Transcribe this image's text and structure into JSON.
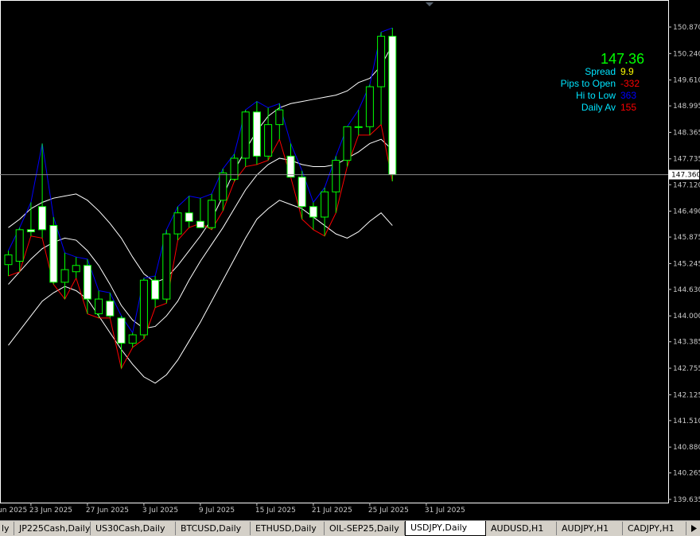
{
  "chart_data": {
    "type": "candlestick",
    "symbol_timeframe": "USDJPY,Daily",
    "ylim": [
      139.635,
      151.05
    ],
    "y_ticks": [
      "150.870",
      "150.240",
      "149.610",
      "148.995",
      "148.365",
      "147.735",
      "147.120",
      "146.490",
      "145.875",
      "145.245",
      "144.630",
      "144.000",
      "143.385",
      "142.755",
      "142.125",
      "141.510",
      "140.880",
      "140.265",
      "139.635"
    ],
    "x_ticks": [
      "19 Jun 2025",
      "23 Jun 2025",
      "27 Jun 2025",
      "3 Jul 2025",
      "9 Jul 2025",
      "15 Jul 2025",
      "21 Jul 2025",
      "25 Jul 2025",
      "31 Jul 2025"
    ],
    "x_tick_bars": [
      -2,
      2,
      7,
      12,
      17,
      22,
      27,
      32,
      37
    ],
    "current_price": "147.360",
    "candles": [
      {
        "o": 145.22,
        "h": 145.55,
        "l": 144.95,
        "c": 145.45
      },
      {
        "o": 145.3,
        "h": 146.1,
        "l": 145.05,
        "c": 146.05
      },
      {
        "o": 146.05,
        "h": 146.7,
        "l": 145.9,
        "c": 146.0
      },
      {
        "o": 146.6,
        "h": 148.1,
        "l": 145.85,
        "c": 146.05
      },
      {
        "o": 146.15,
        "h": 146.35,
        "l": 144.75,
        "c": 144.8
      },
      {
        "o": 144.8,
        "h": 145.5,
        "l": 144.4,
        "c": 145.1
      },
      {
        "o": 145.05,
        "h": 145.4,
        "l": 144.9,
        "c": 145.2
      },
      {
        "o": 145.2,
        "h": 145.35,
        "l": 144.05,
        "c": 144.4
      },
      {
        "o": 144.05,
        "h": 144.6,
        "l": 143.95,
        "c": 144.4
      },
      {
        "o": 144.35,
        "h": 144.55,
        "l": 143.95,
        "c": 144.0
      },
      {
        "o": 143.95,
        "h": 144.0,
        "l": 142.75,
        "c": 143.35
      },
      {
        "o": 143.35,
        "h": 143.6,
        "l": 143.25,
        "c": 143.55
      },
      {
        "o": 143.55,
        "h": 144.9,
        "l": 143.45,
        "c": 144.85
      },
      {
        "o": 144.85,
        "h": 144.95,
        "l": 144.2,
        "c": 144.4
      },
      {
        "o": 144.4,
        "h": 146.05,
        "l": 144.3,
        "c": 145.95
      },
      {
        "o": 145.95,
        "h": 146.6,
        "l": 145.8,
        "c": 146.45
      },
      {
        "o": 146.45,
        "h": 146.85,
        "l": 146.1,
        "c": 146.25
      },
      {
        "o": 146.25,
        "h": 146.8,
        "l": 146.2,
        "c": 146.1
      },
      {
        "o": 146.1,
        "h": 146.9,
        "l": 146.05,
        "c": 146.75
      },
      {
        "o": 146.75,
        "h": 147.5,
        "l": 146.5,
        "c": 147.4
      },
      {
        "o": 147.25,
        "h": 147.85,
        "l": 147.2,
        "c": 147.75
      },
      {
        "o": 147.75,
        "h": 148.9,
        "l": 147.55,
        "c": 148.85
      },
      {
        "o": 148.85,
        "h": 149.1,
        "l": 147.6,
        "c": 147.8
      },
      {
        "o": 147.8,
        "h": 148.95,
        "l": 147.7,
        "c": 148.55
      },
      {
        "o": 148.55,
        "h": 149.05,
        "l": 148.2,
        "c": 148.9
      },
      {
        "o": 147.8,
        "h": 148.1,
        "l": 147.3,
        "c": 147.3
      },
      {
        "o": 147.3,
        "h": 147.45,
        "l": 146.3,
        "c": 146.6
      },
      {
        "o": 146.6,
        "h": 146.7,
        "l": 146.05,
        "c": 146.35
      },
      {
        "o": 146.35,
        "h": 147.05,
        "l": 145.9,
        "c": 146.95
      },
      {
        "o": 146.95,
        "h": 147.8,
        "l": 146.45,
        "c": 147.7
      },
      {
        "o": 147.7,
        "h": 148.5,
        "l": 147.55,
        "c": 148.5
      },
      {
        "o": 148.5,
        "h": 148.9,
        "l": 148.3,
        "c": 148.5
      },
      {
        "o": 148.5,
        "h": 149.5,
        "l": 148.3,
        "c": 149.45
      },
      {
        "o": 149.45,
        "h": 150.75,
        "l": 148.55,
        "c": 150.65
      },
      {
        "o": 150.65,
        "h": 150.85,
        "l": 147.2,
        "c": 147.36
      }
    ],
    "envelope_upper": [
      146.1,
      146.3,
      146.55,
      146.7,
      146.8,
      146.85,
      146.9,
      146.75,
      146.5,
      146.2,
      145.85,
      145.4,
      145.0,
      144.8,
      144.9,
      145.2,
      145.55,
      145.9,
      146.3,
      146.85,
      147.45,
      147.95,
      148.4,
      148.75,
      148.95,
      149.05,
      149.1,
      149.15,
      149.2,
      149.25,
      149.35,
      149.55,
      149.65,
      149.95,
      150.45
    ],
    "envelope_middle": [
      144.75,
      145.05,
      145.35,
      145.6,
      145.75,
      145.85,
      145.8,
      145.55,
      145.2,
      144.75,
      144.25,
      143.9,
      143.7,
      143.75,
      144.0,
      144.35,
      144.85,
      145.3,
      145.7,
      146.1,
      146.55,
      147.0,
      147.35,
      147.6,
      147.75,
      147.7,
      147.6,
      147.55,
      147.55,
      147.6,
      147.75,
      147.9,
      148.1,
      148.2,
      147.95
    ],
    "envelope_lower": [
      143.3,
      143.65,
      144.0,
      144.35,
      144.55,
      144.7,
      144.6,
      144.4,
      144.0,
      143.6,
      143.2,
      142.85,
      142.55,
      142.4,
      142.6,
      142.95,
      143.4,
      143.85,
      144.35,
      144.85,
      145.35,
      145.85,
      146.3,
      146.55,
      146.75,
      146.65,
      146.55,
      146.35,
      146.15,
      145.95,
      145.85,
      146.0,
      146.25,
      146.45,
      146.15
    ],
    "envelope_offsets": [
      0,
      0,
      0,
      0,
      0,
      0,
      0,
      0,
      0,
      0,
      0,
      0,
      1,
      1,
      1,
      1,
      1,
      1,
      1,
      1,
      1,
      1,
      1,
      1,
      2,
      2,
      2,
      2,
      2,
      2,
      2,
      2,
      2,
      2,
      2
    ]
  },
  "info_panel": {
    "price": "147.36",
    "rows": [
      {
        "label": "Spread",
        "value": "9.9",
        "value_color": "#ffff00"
      },
      {
        "label": "Pips to Open",
        "value": "-332",
        "value_color": "#ff0000"
      },
      {
        "label": "Hi to Low",
        "value": "363",
        "value_color": "#0000ff"
      },
      {
        "label": "Daily Av",
        "value": "155",
        "value_color": "#ff0000"
      }
    ],
    "label_color": "#00e5ff",
    "price_color": "#00ff00"
  },
  "colors": {
    "bull_body": "#000000",
    "bull_edge": "#00ff00",
    "bear_body": "#ffffff",
    "bear_edge": "#00ff00",
    "wick": "#00ff00",
    "hi_line": "#0000ff",
    "lo_line": "#ff0000",
    "envelope": "#ffffff",
    "axis_text": "#c8c8c8"
  },
  "tabs": [
    {
      "label": "ly"
    },
    {
      "label": "JP225Cash,Daily"
    },
    {
      "label": "US30Cash,Daily"
    },
    {
      "label": "BTCUSD,Daily"
    },
    {
      "label": "ETHUSD,Daily"
    },
    {
      "label": "OIL-SEP25,Daily"
    },
    {
      "label": "USDJPY,Daily",
      "active": true
    },
    {
      "label": "AUDUSD,H1"
    },
    {
      "label": "AUDJPY,H1"
    },
    {
      "label": "CADJPY,H1"
    }
  ],
  "tab_scroll_icon": "triangle-right-icon"
}
